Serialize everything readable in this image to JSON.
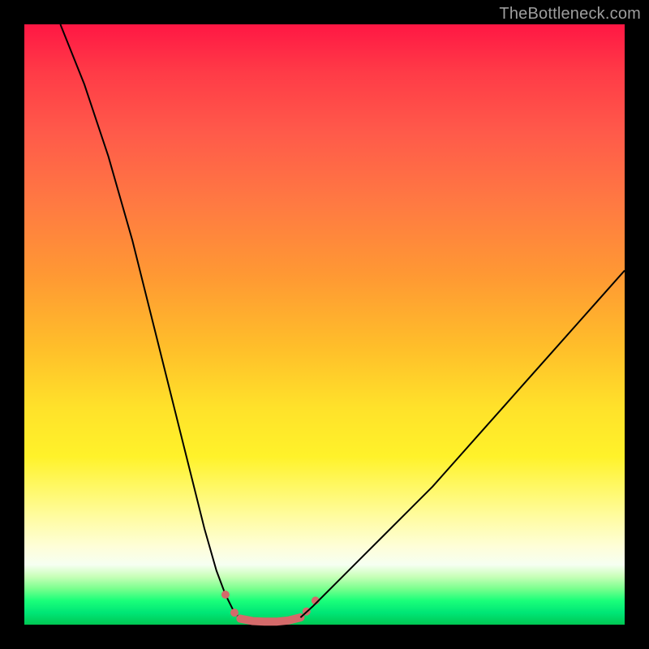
{
  "watermark": "TheBottleneck.com",
  "chart_data": {
    "type": "line",
    "title": "",
    "xlabel": "",
    "ylabel": "",
    "xlim": [
      0,
      100
    ],
    "ylim": [
      0,
      100
    ],
    "background_gradient": {
      "orientation": "vertical",
      "stops": [
        {
          "pct": 0,
          "color": "#ff1744"
        },
        {
          "pct": 50,
          "color": "#ffbf2a"
        },
        {
          "pct": 80,
          "color": "#fffca0"
        },
        {
          "pct": 95,
          "color": "#1aff7a"
        },
        {
          "pct": 100,
          "color": "#00c853"
        }
      ]
    },
    "series": [
      {
        "name": "left-descent",
        "x": [
          6,
          8,
          10,
          12,
          14,
          16,
          18,
          20,
          22,
          24,
          26,
          28,
          30,
          32,
          33.5,
          35,
          36
        ],
        "values": [
          100,
          95,
          90,
          84,
          78,
          71,
          64,
          56,
          48,
          40,
          32,
          24,
          16,
          9,
          5,
          2,
          1
        ],
        "stroke": "#000000",
        "stroke_width": 2
      },
      {
        "name": "flat-valley-marker",
        "x": [
          36,
          38,
          40,
          42,
          44,
          46
        ],
        "values": [
          1,
          0.6,
          0.5,
          0.5,
          0.7,
          1.2
        ],
        "stroke": "#d46a6a",
        "stroke_width": 10,
        "cap": "round",
        "dots_x": [
          33.5,
          35,
          36,
          46,
          47,
          48.5
        ],
        "dots_values": [
          5,
          2,
          1,
          1.2,
          2.2,
          4
        ]
      },
      {
        "name": "right-ascent",
        "x": [
          46,
          48,
          50,
          53,
          56,
          60,
          64,
          68,
          72,
          76,
          80,
          84,
          88,
          92,
          96,
          100
        ],
        "values": [
          1.2,
          3,
          5,
          8,
          11,
          15,
          19,
          23,
          27.5,
          32,
          36.5,
          41,
          45.5,
          50,
          54.5,
          59
        ],
        "stroke": "#000000",
        "stroke_width": 2
      }
    ]
  }
}
